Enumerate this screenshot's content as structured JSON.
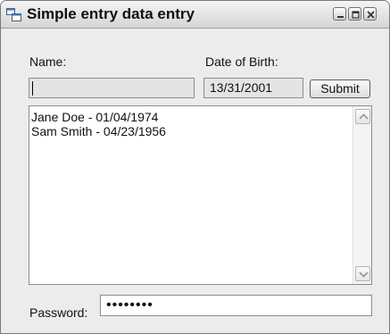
{
  "window": {
    "title": "Simple entry data entry",
    "icons": {
      "app": "app-window-icon",
      "minimize": "minimize-icon",
      "maximize": "maximize-icon",
      "close": "close-icon"
    }
  },
  "form": {
    "name_label": "Name:",
    "name_value": "",
    "dob_label": "Date of Birth:",
    "dob_value": "13/31/2001",
    "submit_label": "Submit",
    "password_label": "Password:",
    "password_value": "••••••••"
  },
  "entries": [
    "Jane Doe - 01/04/1974",
    "Sam Smith - 04/23/1956"
  ],
  "scrollbar": {
    "up_icon": "chevron-up-icon",
    "down_icon": "chevron-down-icon"
  },
  "colors": {
    "window_bg": "#ececec",
    "disabled_field_bg": "#e4e4e4",
    "border": "#8c8c8c"
  }
}
